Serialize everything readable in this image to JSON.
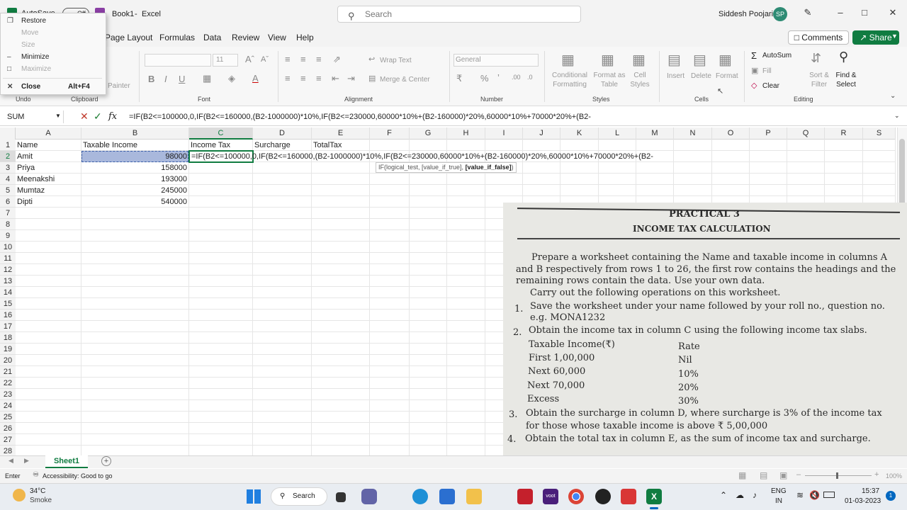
{
  "titlebar": {
    "autosave": "AutoSave",
    "toggle": "Off",
    "doc_title": "Book1",
    "app": "Excel",
    "search": "Search",
    "user": "Siddesh Poojari",
    "initials": "SP"
  },
  "system_menu": [
    {
      "label": "Restore",
      "enabled": true
    },
    {
      "label": "Move",
      "enabled": false
    },
    {
      "label": "Size",
      "enabled": false
    },
    {
      "label": "Minimize",
      "enabled": true
    },
    {
      "label": "Maximize",
      "enabled": false
    },
    {
      "label": "Close",
      "shortcut": "Alt+F4",
      "enabled": true
    }
  ],
  "tabs": [
    "Page Layout",
    "Formulas",
    "Data",
    "Review",
    "View",
    "Help"
  ],
  "comments": "Comments",
  "share": "Share",
  "ribbon": {
    "undo": "Undo",
    "clipboard": "Clipboard",
    "painter": "Painter",
    "font": "Font",
    "font_size": "11",
    "alignment": "Alignment",
    "wrap": "Wrap Text",
    "merge": "Merge & Center",
    "number": "Number",
    "number_format": "General",
    "styles": "Styles",
    "cond1": "Conditional",
    "cond2": "Formatting",
    "fmt_table1": "Format as",
    "fmt_table2": "Table",
    "cell_styles1": "Cell",
    "cell_styles2": "Styles",
    "cells": "Cells",
    "insert": "Insert",
    "delete": "Delete",
    "format": "Format",
    "autosum": "AutoSum",
    "fill": "Fill",
    "clear": "Clear",
    "sort1": "Sort &",
    "sort2": "Filter",
    "find1": "Find &",
    "find2": "Select",
    "editing": "Editing"
  },
  "formula_bar": {
    "name_box": "SUM",
    "fx": "fx",
    "formula": "=IF(B2<=100000,0,IF(B2<=160000,(B2-1000000)*10%,IF(B2<=230000,60000*10%+(B2-160000)*20%,60000*10%+70000*20%+(B2-"
  },
  "columns": [
    "A",
    "B",
    "C",
    "D",
    "E",
    "F",
    "G",
    "H",
    "I",
    "J",
    "K",
    "L",
    "M",
    "N",
    "O",
    "P",
    "Q",
    "R",
    "S"
  ],
  "rows": [
    "1",
    "2",
    "3",
    "4",
    "5",
    "6",
    "7",
    "8",
    "9",
    "10",
    "11",
    "12",
    "13",
    "14",
    "15",
    "16",
    "17",
    "18",
    "19",
    "20",
    "21",
    "22",
    "23",
    "24",
    "25",
    "26",
    "27",
    "28"
  ],
  "headers": {
    "a": "Name",
    "b": "Taxable Income",
    "c": "Income Tax",
    "d": "Surcharge",
    "e": "TotalTax"
  },
  "data_rows": [
    {
      "name": "Amit",
      "income": "98000"
    },
    {
      "name": "Priya",
      "income": "158000"
    },
    {
      "name": "Meenakshi",
      "income": "193000"
    },
    {
      "name": "Mumtaz",
      "income": "245000"
    },
    {
      "name": "Dipti",
      "income": "540000"
    }
  ],
  "cell_edit": "=IF(B2<=100000,0,IF(B2<=160000,(B2-1000000)*10%,IF(B2<=230000,60000*10%+(B2-160000)*20%,60000*10%+70000*20%+(B2-",
  "tooltip": {
    "args": "IF(logical_test, [value_if_true], ",
    "bold": "[value_if_false]",
    "end": ")"
  },
  "sheet": "Sheet1",
  "status": {
    "mode": "Enter",
    "accessibility": "Accessibility: Good to go",
    "zoom": "100%"
  },
  "photo": {
    "title": "PRACTICAL 3",
    "subtitle": "INCOME TAX CALCULATION",
    "lines": [
      "Prepare a worksheet containing the Name and taxable income in columns A",
      "and B respectively from rows 1 to 26, the first row contains the headings and the",
      "remaining rows contain the data. Use your own data.",
      "Carry out the following operations on this worksheet.",
      "1.",
      "Save the worksheet under your name followed by your roll no., question no.",
      "e.g. MONA1232",
      "2.",
      "Obtain the income tax in column C using the following income tax slabs.",
      "3.",
      "Obtain the surcharge in column D, where surcharge is 3% of the income tax",
      "for those whose taxable income is above ₹ 5,00,000",
      "4.",
      "Obtain the total tax in column E, as the sum of income tax and surcharge."
    ],
    "slabs": [
      {
        "label": "Taxable Income(₹)",
        "rate": "Rate"
      },
      {
        "label": "First 1,00,000",
        "rate": "Nil"
      },
      {
        "label": "Next 60,000",
        "rate": "10%"
      },
      {
        "label": "Next 70,000",
        "rate": "20%"
      },
      {
        "label": "Excess",
        "rate": "30%"
      }
    ]
  },
  "taskbar": {
    "weather_temp": "34°C",
    "weather_desc": "Smoke",
    "search": "Search",
    "lang1": "ENG",
    "lang2": "IN",
    "time": "15:37",
    "date": "01-03-2023",
    "notif": "1"
  }
}
